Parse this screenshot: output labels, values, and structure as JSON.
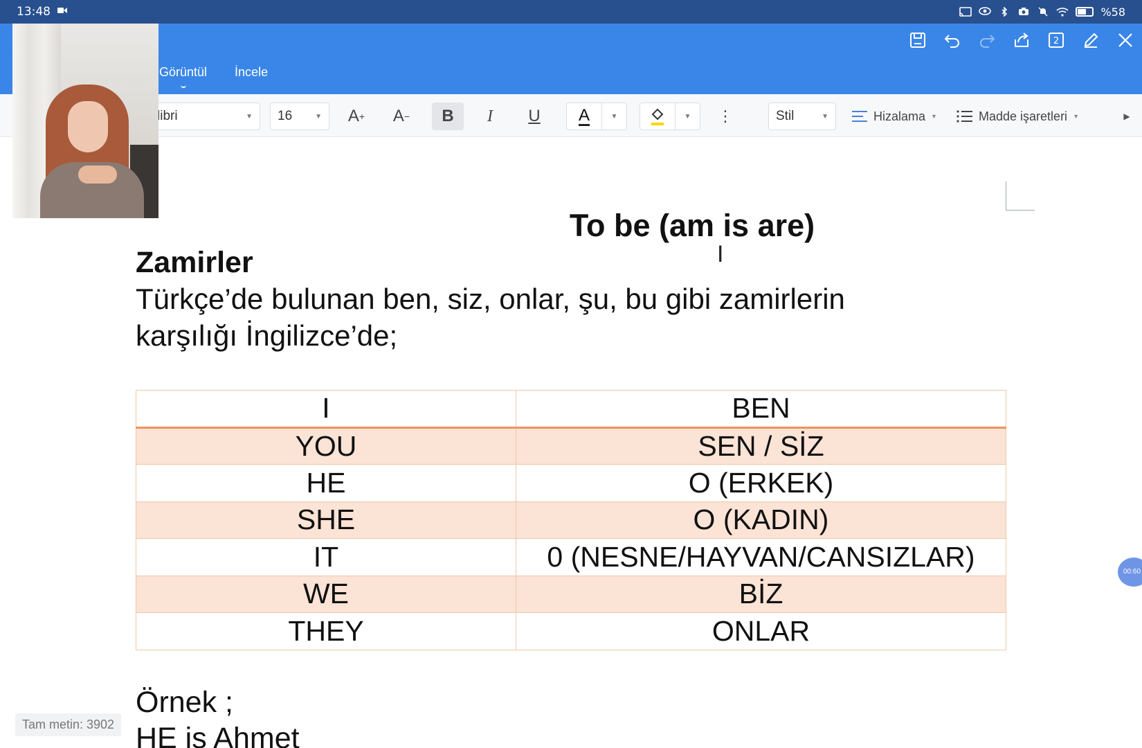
{
  "status_bar": {
    "time": "13:48",
    "battery_text": "%58",
    "battery_level": 0.58,
    "icons": [
      "video-record-icon",
      "cast-icon",
      "eye-icon",
      "bluetooth-icon",
      "camera-icon",
      "mute-icon",
      "wifi-icon",
      "battery-icon"
    ]
  },
  "header": {
    "tabs": [
      {
        "label": "Görüntül",
        "active": true
      },
      {
        "label": "İncele",
        "active": false
      }
    ],
    "actions": [
      "save-icon",
      "undo-icon",
      "redo-icon",
      "share-icon",
      "page-count-icon",
      "edit-icon",
      "close-icon"
    ],
    "page_count": "2"
  },
  "toolbar": {
    "font_name": "libri",
    "font_size": "16",
    "increase_font": "A",
    "decrease_font": "A",
    "bold": "B",
    "italic": "I",
    "underline": "U",
    "font_color": "A",
    "style_label": "Stil",
    "align_label": "Hizalama",
    "bullets_label": "Madde işaretleri",
    "accent_highlight": "#f5d90a"
  },
  "document": {
    "title": "To be (am is are)",
    "heading": "Zamirler",
    "paragraph": "Türkçe’de bulunan ben, siz, onlar, şu, bu gibi zamirlerin karşılığı İngilizce’de;",
    "table": [
      [
        "I",
        "BEN"
      ],
      [
        "YOU",
        "SEN / SİZ"
      ],
      [
        "HE",
        "O (ERKEK)"
      ],
      [
        "SHE",
        "O (KADIN)"
      ],
      [
        "IT",
        "0 (NESNE/HAYVAN/CANSIZLAR)"
      ],
      [
        "WE",
        "BİZ"
      ],
      [
        "THEY",
        "ONLAR"
      ]
    ],
    "example_label": "Örnek ;",
    "example_line": "HE is Ahmet"
  },
  "footer": {
    "word_count": "Tam metin: 3902",
    "bubble": "00:60"
  },
  "colors": {
    "status_bar": "#28508f",
    "header": "#3a86e8",
    "table_shade": "#fbe3d6",
    "table_border": "#f2c6a8",
    "table_header_rule": "#f0935c"
  }
}
